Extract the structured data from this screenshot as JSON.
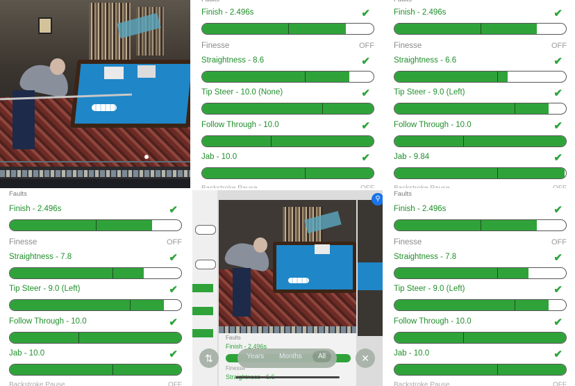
{
  "panels": {
    "faults_label": "Faults",
    "finesse_label": "Finesse",
    "finesse_value": "OFF",
    "cutoff_label": "Backstroke Pause",
    "cutoff_value": "OFF",
    "top_mid": [
      {
        "label": "Finish - 2.496s",
        "fill": 0.84,
        "tick": 0.5
      },
      {
        "label": "Straightness - 8.6",
        "fill": 0.86,
        "tick": 0.6
      },
      {
        "label": "Tip Steer - 10.0 (None)",
        "fill": 1.0,
        "tick": 0.7
      },
      {
        "label": "Follow Through - 10.0",
        "fill": 1.0,
        "tick": 0.4
      },
      {
        "label": "Jab - 10.0",
        "fill": 1.0,
        "tick": 0.6
      }
    ],
    "top_right": [
      {
        "label": "Finish - 2.496s",
        "fill": 0.83,
        "tick": 0.5
      },
      {
        "label": "Straightness - 6.6",
        "fill": 0.66,
        "tick": 0.6
      },
      {
        "label": "Tip Steer - 9.0 (Left)",
        "fill": 0.9,
        "tick": 0.7
      },
      {
        "label": "Follow Through - 10.0",
        "fill": 1.0,
        "tick": 0.4
      },
      {
        "label": "Jab - 9.84",
        "fill": 0.99,
        "tick": 0.6
      }
    ],
    "bottom_left": [
      {
        "label": "Finish - 2.496s",
        "fill": 0.83,
        "tick": 0.5
      },
      {
        "label": "Straightness - 7.8",
        "fill": 0.78,
        "tick": 0.6
      },
      {
        "label": "Tip Steer - 9.0 (Left)",
        "fill": 0.9,
        "tick": 0.7
      },
      {
        "label": "Follow Through - 10.0",
        "fill": 1.0,
        "tick": 0.4
      },
      {
        "label": "Jab - 10.0",
        "fill": 1.0,
        "tick": 0.6
      }
    ],
    "bottom_right": [
      {
        "label": "Finish - 2.496s",
        "fill": 0.83,
        "tick": 0.5
      },
      {
        "label": "Straightness - 7.8",
        "fill": 0.78,
        "tick": 0.6
      },
      {
        "label": "Tip Steer - 9.0 (Left)",
        "fill": 0.9,
        "tick": 0.7
      },
      {
        "label": "Follow Through - 10.0",
        "fill": 1.0,
        "tick": 0.4
      },
      {
        "label": "Jab - 10.0",
        "fill": 1.0,
        "tick": 0.6
      }
    ]
  },
  "center": {
    "faults_label": "Faults",
    "finish_label": "Finish - 2.496s",
    "finesse_label": "Finesse",
    "finesse_value": "OFF",
    "straightness_label": "Straightness - 6.6",
    "filter_years": "Years",
    "filter_months": "Months",
    "filter_all": "All",
    "sort_icon": "sort-arrows-icon",
    "close_icon": "close-icon",
    "search_icon": "search-icon"
  },
  "colors": {
    "green": "#2fa33a",
    "check": "#2fa33a",
    "felt": "#1f86c8"
  }
}
